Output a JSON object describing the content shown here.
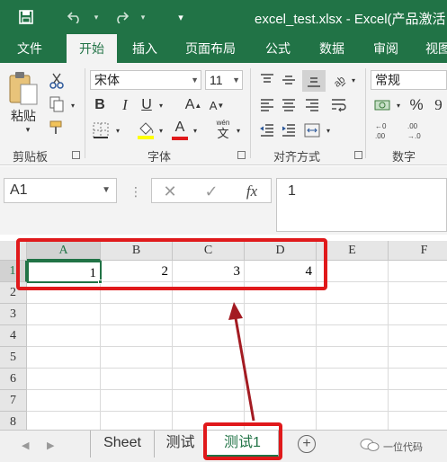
{
  "window": {
    "title": "excel_test.xlsx - Excel(产品激活",
    "qat": {
      "save_icon": "save-icon",
      "undo_icon": "undo-icon",
      "redo_icon": "redo-icon"
    }
  },
  "ribbon_tabs": [
    "文件",
    "开始",
    "插入",
    "页面布局",
    "公式",
    "数据",
    "审阅",
    "视图"
  ],
  "active_tab": "开始",
  "ribbon": {
    "clipboard": {
      "paste_label": "粘贴",
      "group_label": "剪贴板"
    },
    "font": {
      "font_name": "宋体",
      "font_size": "11",
      "bold": "B",
      "italic": "I",
      "underline": "U",
      "grow": "A",
      "shrink": "A",
      "font_color_letter": "A",
      "wen": "wén",
      "wen_char": "文",
      "group_label": "字体",
      "font_color": "#e0191b",
      "fill_color": "#ffff00"
    },
    "alignment": {
      "group_label": "对齐方式"
    },
    "number": {
      "format": "常规",
      "percent": "%",
      "comma": "9",
      "group_label": "数字"
    }
  },
  "formula_bar": {
    "name_box": "A1",
    "cancel": "✕",
    "enter": "✓",
    "fx": "fx",
    "value": "1"
  },
  "grid": {
    "columns": [
      "A",
      "B",
      "C",
      "D",
      "E",
      "F"
    ],
    "rows": [
      "1",
      "2",
      "3",
      "4",
      "5",
      "6",
      "7",
      "8"
    ],
    "row1_values": [
      "1",
      "2",
      "3",
      "4"
    ],
    "selected_cell": "A1"
  },
  "sheets": {
    "tabs": [
      "Sheet",
      "测试",
      "测试1"
    ],
    "active": "测试1",
    "add_label": "+"
  },
  "watermark": "一位代码",
  "colors": {
    "accent": "#217346",
    "annotation": "#e0191b"
  }
}
